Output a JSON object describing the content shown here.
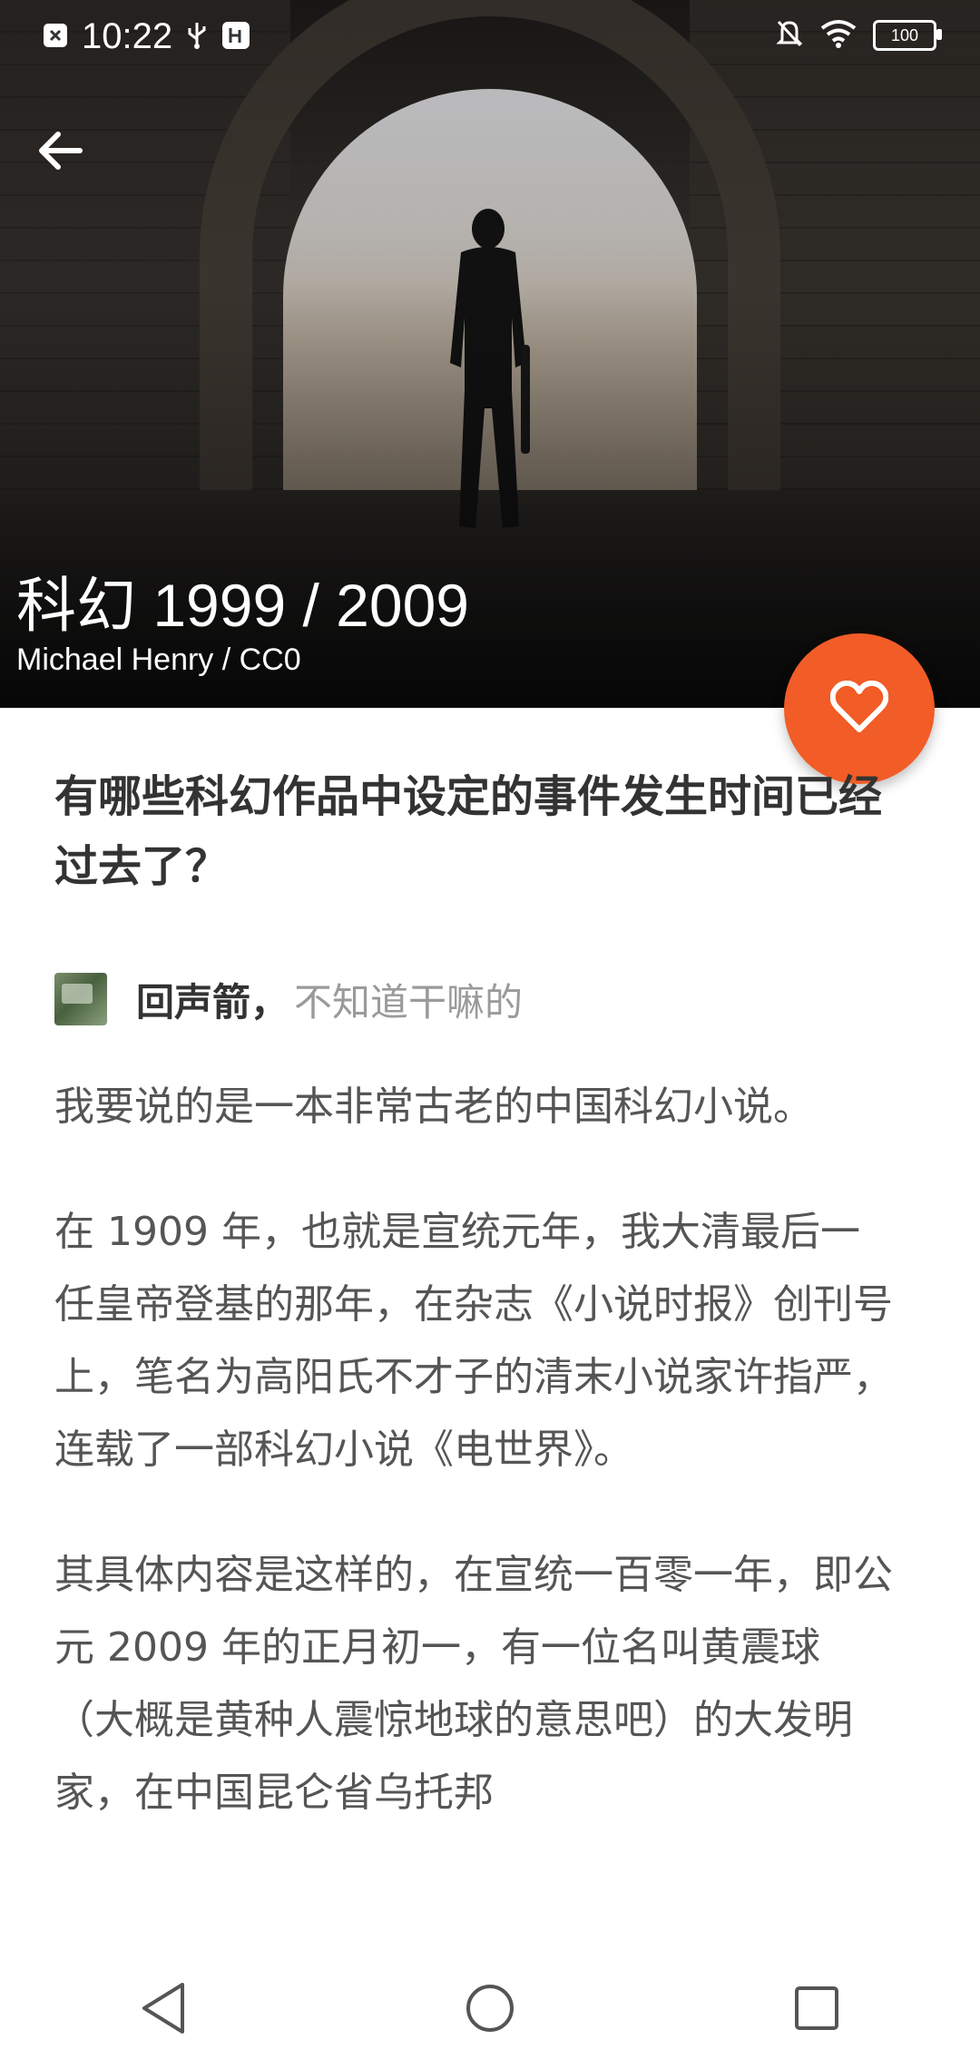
{
  "status_bar": {
    "time": "10:22",
    "battery": "100",
    "left_icons": [
      "close-box-icon",
      "usb-icon",
      "usb-debug-icon"
    ],
    "right_icons": [
      "notifications-off-icon",
      "wifi-icon",
      "battery-icon"
    ]
  },
  "hero": {
    "title": "科幻 1999 / 2009",
    "credit": "Michael Henry / CC0"
  },
  "actions": {
    "back_icon": "back-arrow-icon",
    "favorite_icon": "heart-icon",
    "fab_color": "#f25c26"
  },
  "article": {
    "question": "有哪些科幻作品中设定的事件发生时间已经过去了？",
    "author": {
      "name": "回声箭",
      "separator": "，",
      "bio": "不知道干嘛的"
    },
    "paragraphs": [
      "我要说的是一本非常古老的中国科幻小说。",
      "在 1909 年，也就是宣统元年，我大清最后一任皇帝登基的那年，在杂志《小说时报》创刊号上，笔名为高阳氏不才子的清末小说家许指严，连载了一部科幻小说《电世界》。",
      "其具体内容是这样的，在宣统一百零一年，即公元 2009 年的正月初一，有一位名叫黄震球（大概是黄种人震惊地球的意思吧）的大发明家，在中国昆仑省乌托邦"
    ]
  },
  "navigation": {
    "back": "nav-back-triangle-icon",
    "home": "nav-home-circle-icon",
    "recents": "nav-recents-square-icon"
  }
}
